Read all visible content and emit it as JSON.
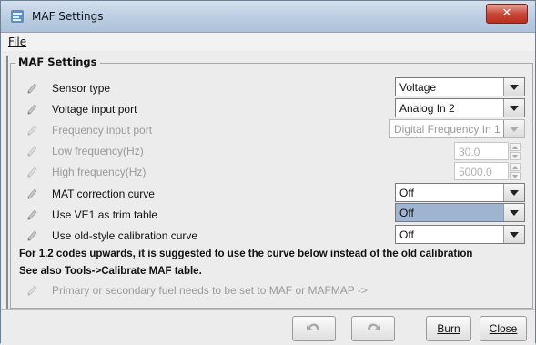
{
  "window": {
    "title": "MAF Settings",
    "close_icon": "close-icon"
  },
  "menu": {
    "file_label": "File"
  },
  "group": {
    "title": "MAF Settings"
  },
  "rows": [
    {
      "label": "Sensor type",
      "value": "Voltage",
      "control": "combo",
      "enabled": true
    },
    {
      "label": "Voltage input port",
      "value": "Analog In 2",
      "control": "combo",
      "enabled": true
    },
    {
      "label": "Frequency input port",
      "value": "Digital Frequency In 1",
      "control": "combo",
      "enabled": false
    },
    {
      "label": "Low frequency(Hz)",
      "value": "30.0",
      "control": "spinner",
      "enabled": false
    },
    {
      "label": "High frequency(Hz)",
      "value": "5000.0",
      "control": "spinner",
      "enabled": false
    },
    {
      "label": "MAT correction curve",
      "value": "Off",
      "control": "combo",
      "enabled": true
    },
    {
      "label": "Use VE1 as trim table",
      "value": "Off",
      "control": "combo",
      "enabled": true,
      "selected": true
    },
    {
      "label": "Use old-style calibration curve",
      "value": "Off",
      "control": "combo",
      "enabled": true
    }
  ],
  "notes": {
    "line1": "For 1.2 codes upwards, it is suggested to use the curve below instead of the old calibration",
    "line2": "See also Tools->Calibrate MAF table.",
    "fuel_hint": "Primary or secondary fuel needs to be set to MAF or MAFMAP ->"
  },
  "buttons": {
    "burn_label": "Burn",
    "close_label": "Close",
    "undo_icon": "undo-icon",
    "redo_icon": "redo-icon"
  },
  "colors": {
    "selected_combo": "#9fb4d0",
    "close_button": "#c9483a"
  }
}
